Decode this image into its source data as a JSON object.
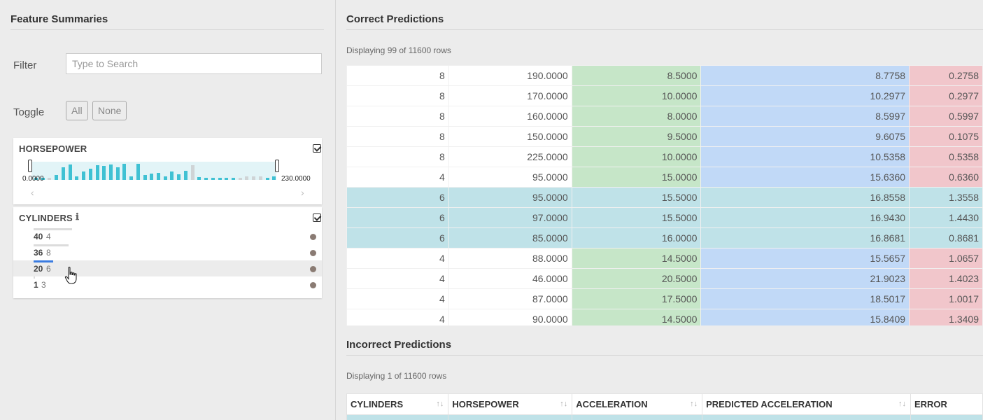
{
  "left": {
    "title": "Feature Summaries",
    "filter": {
      "label": "Filter",
      "placeholder": "Type to Search",
      "value": ""
    },
    "toggle": {
      "label": "Toggle",
      "all_label": "All",
      "none_label": "None"
    },
    "horsepower": {
      "title": "HORSEPOWER",
      "min_label": "0.0000",
      "max_label": "230.0000",
      "checked": true,
      "bars": [
        {
          "v": 0.1,
          "c": "teal"
        },
        {
          "v": 0.1,
          "c": "teal"
        },
        {
          "v": 0.12,
          "c": "gray"
        },
        {
          "v": 0.25,
          "c": "teal"
        },
        {
          "v": 0.7,
          "c": "teal"
        },
        {
          "v": 0.85,
          "c": "teal"
        },
        {
          "v": 0.2,
          "c": "teal"
        },
        {
          "v": 0.45,
          "c": "teal"
        },
        {
          "v": 0.6,
          "c": "teal"
        },
        {
          "v": 0.8,
          "c": "teal"
        },
        {
          "v": 0.75,
          "c": "teal"
        },
        {
          "v": 0.85,
          "c": "teal"
        },
        {
          "v": 0.7,
          "c": "teal"
        },
        {
          "v": 0.9,
          "c": "teal"
        },
        {
          "v": 0.2,
          "c": "teal"
        },
        {
          "v": 0.9,
          "c": "teal"
        },
        {
          "v": 0.25,
          "c": "teal"
        },
        {
          "v": 0.35,
          "c": "teal"
        },
        {
          "v": 0.4,
          "c": "teal"
        },
        {
          "v": 0.2,
          "c": "teal"
        },
        {
          "v": 0.45,
          "c": "teal"
        },
        {
          "v": 0.3,
          "c": "teal"
        },
        {
          "v": 0.5,
          "c": "teal"
        },
        {
          "v": 0.8,
          "c": "gray"
        },
        {
          "v": 0.15,
          "c": "teal"
        },
        {
          "v": 0.12,
          "c": "teal"
        },
        {
          "v": 0.12,
          "c": "teal"
        },
        {
          "v": 0.12,
          "c": "teal"
        },
        {
          "v": 0.12,
          "c": "teal"
        },
        {
          "v": 0.12,
          "c": "teal"
        },
        {
          "v": 0.12,
          "c": "gray"
        },
        {
          "v": 0.2,
          "c": "gray"
        },
        {
          "v": 0.2,
          "c": "gray"
        },
        {
          "v": 0.2,
          "c": "gray"
        },
        {
          "v": 0.12,
          "c": "teal"
        },
        {
          "v": 0.2,
          "c": "teal"
        }
      ]
    },
    "cylinders": {
      "title": "CYLINDERS",
      "info_icon": "info-icon",
      "checked": true,
      "rows": [
        {
          "value": "4",
          "count": "40",
          "bar": 1.0,
          "color": "#dcdcdc"
        },
        {
          "value": "8",
          "count": "36",
          "bar": 0.9,
          "color": "#dcdcdc"
        },
        {
          "value": "6",
          "count": "20",
          "bar": 0.5,
          "color": "#3a7be0"
        },
        {
          "value": "3",
          "count": "1",
          "bar": 0.03,
          "color": "#dcdcdc"
        }
      ]
    }
  },
  "correct": {
    "title": "Correct Predictions",
    "subtitle": "Displaying 99 of 11600 rows",
    "rows": [
      {
        "style": "plain",
        "cells": [
          "8",
          "190.0000",
          "8.5000",
          "8.7758",
          "0.2758"
        ]
      },
      {
        "style": "plain",
        "cells": [
          "8",
          "170.0000",
          "10.0000",
          "10.2977",
          "0.2977"
        ]
      },
      {
        "style": "plain",
        "cells": [
          "8",
          "160.0000",
          "8.0000",
          "8.5997",
          "0.5997"
        ]
      },
      {
        "style": "plain",
        "cells": [
          "8",
          "150.0000",
          "9.5000",
          "9.6075",
          "0.1075"
        ]
      },
      {
        "style": "plain",
        "cells": [
          "8",
          "225.0000",
          "10.0000",
          "10.5358",
          "0.5358"
        ]
      },
      {
        "style": "plain",
        "cells": [
          "4",
          "95.0000",
          "15.0000",
          "15.6360",
          "0.6360"
        ]
      },
      {
        "style": "teal",
        "cells": [
          "6",
          "95.0000",
          "15.5000",
          "16.8558",
          "1.3558"
        ]
      },
      {
        "style": "teal",
        "cells": [
          "6",
          "97.0000",
          "15.5000",
          "16.9430",
          "1.4430"
        ]
      },
      {
        "style": "teal",
        "cells": [
          "6",
          "85.0000",
          "16.0000",
          "16.8681",
          "0.8681"
        ]
      },
      {
        "style": "plain",
        "cells": [
          "4",
          "88.0000",
          "14.5000",
          "15.5657",
          "1.0657"
        ]
      },
      {
        "style": "plain",
        "cells": [
          "4",
          "46.0000",
          "20.5000",
          "21.9023",
          "1.4023"
        ]
      },
      {
        "style": "plain",
        "cells": [
          "4",
          "87.0000",
          "17.5000",
          "18.5017",
          "1.0017"
        ]
      },
      {
        "style": "plain",
        "cells": [
          "4",
          "90.0000",
          "14.5000",
          "15.8409",
          "1.3409"
        ]
      }
    ]
  },
  "incorrect": {
    "title": "Incorrect Predictions",
    "subtitle": "Displaying 1 of 11600 rows",
    "columns": [
      "CYLINDERS",
      "HORSEPOWER",
      "ACCELERATION",
      "PREDICTED ACCELERATION",
      "ERROR"
    ],
    "sort_glyph": "↑↓"
  },
  "colors": {
    "teal_bar": "#3fc1d3",
    "gray_bar": "#cfd4d6",
    "hist_band": "#e2f4f7"
  }
}
